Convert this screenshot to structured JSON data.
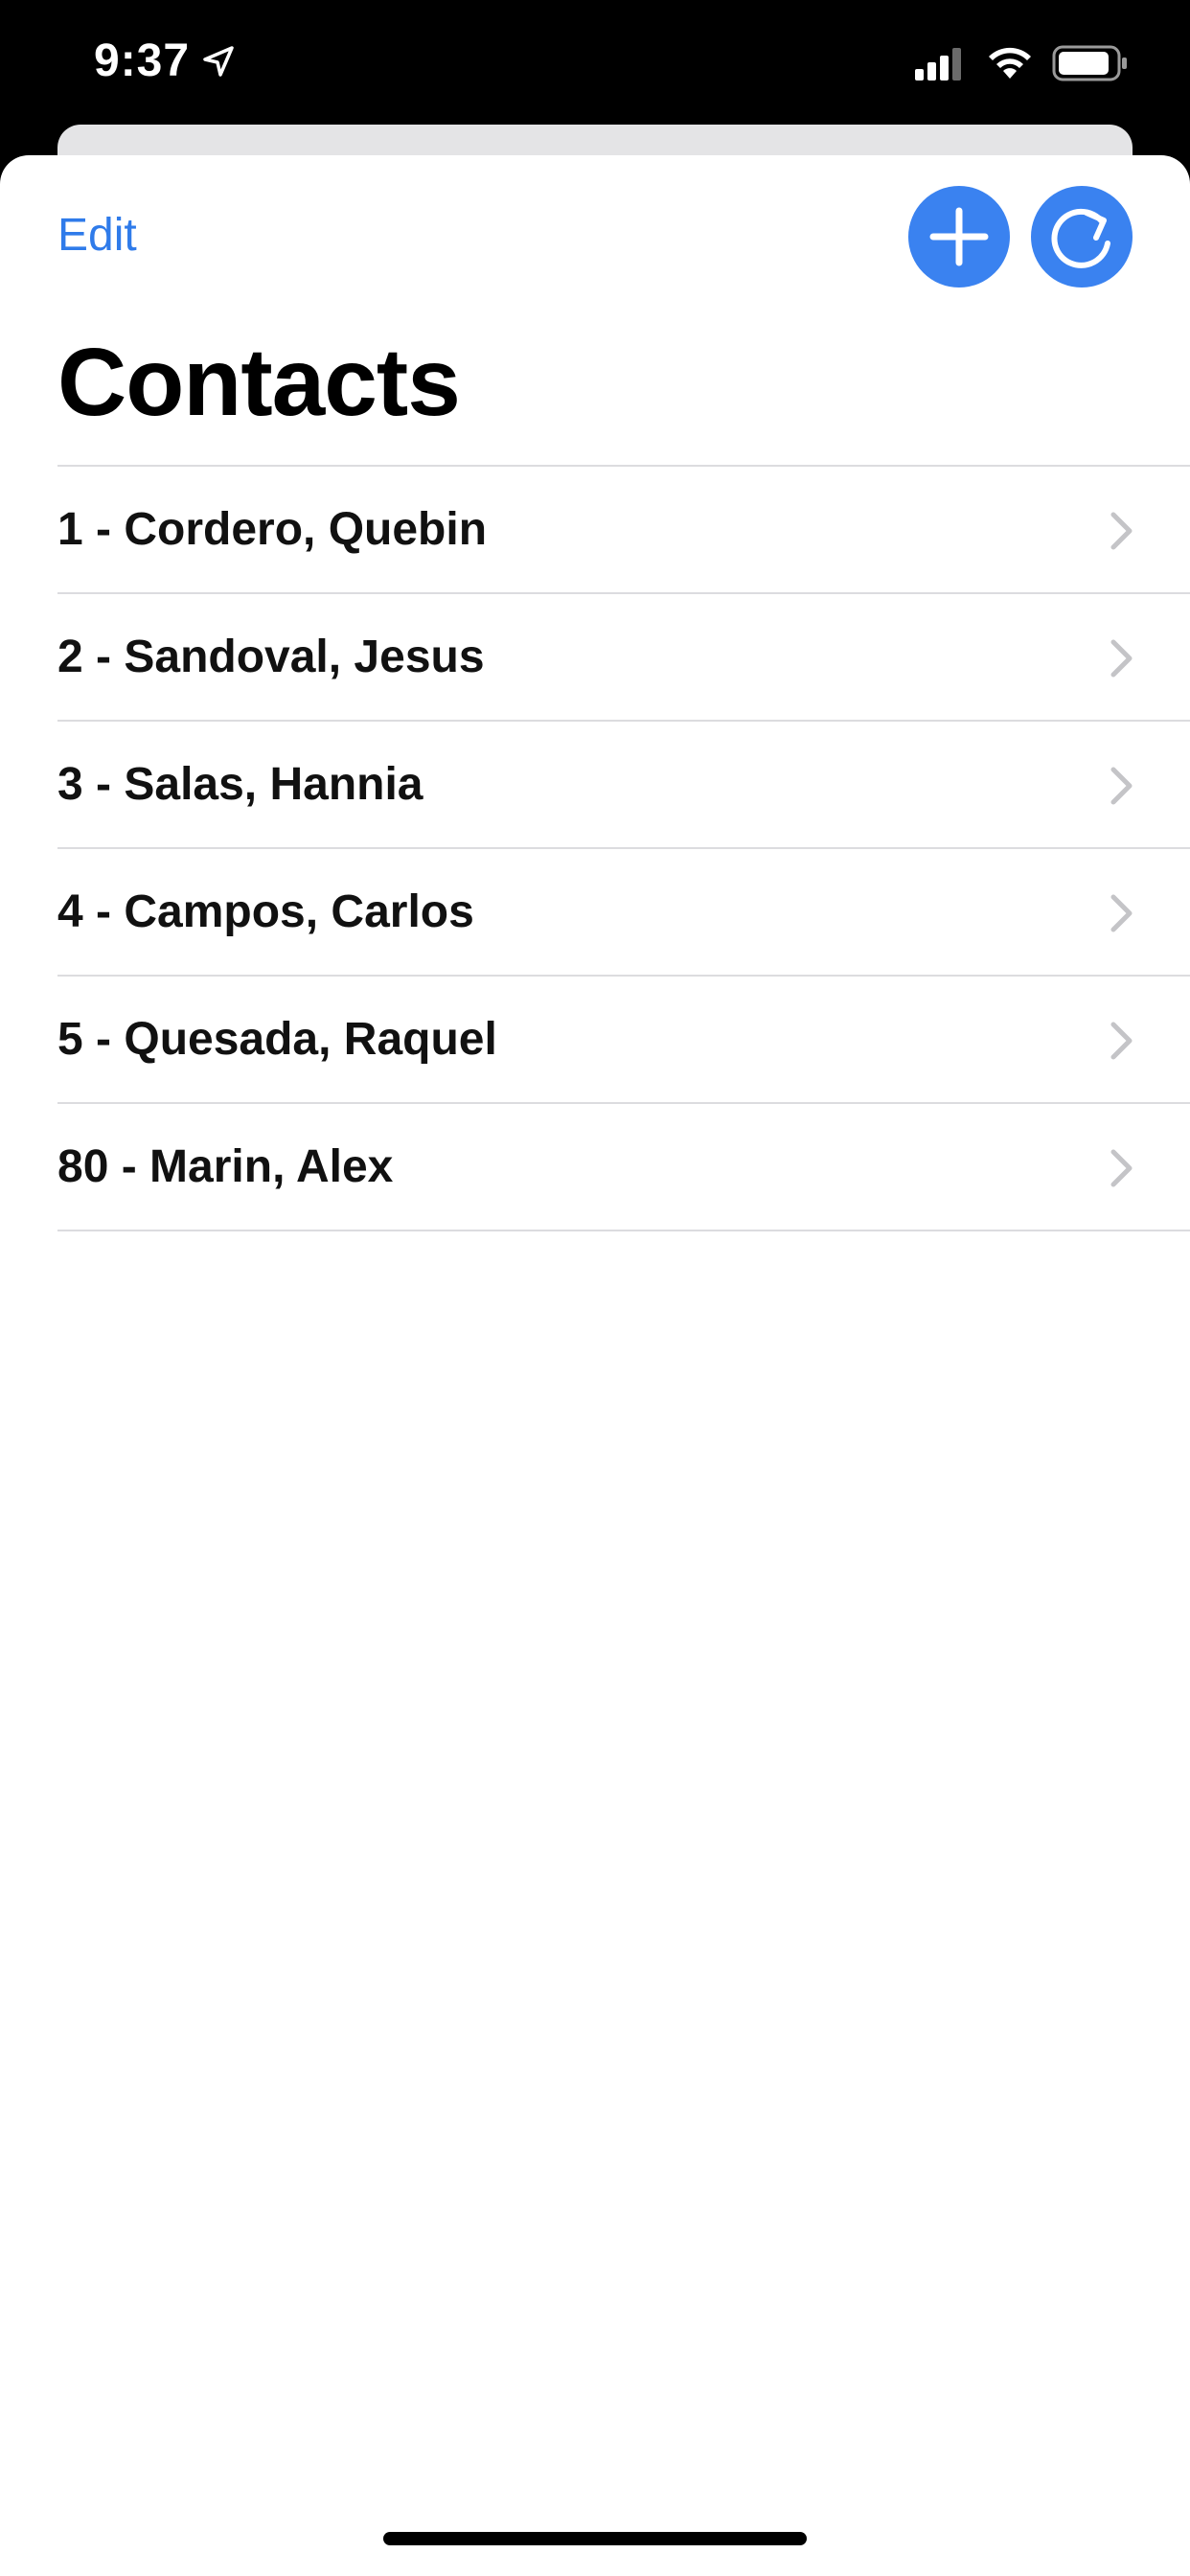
{
  "status_bar": {
    "time": "9:37",
    "icons": [
      "location-arrow-icon",
      "cellular-signal-icon",
      "wifi-icon",
      "battery-icon"
    ]
  },
  "nav": {
    "edit_label": "Edit",
    "add_icon": "plus-icon",
    "refresh_icon": "refresh-icon"
  },
  "page": {
    "title": "Contacts"
  },
  "contacts": [
    {
      "label": "1 - Cordero, Quebin"
    },
    {
      "label": "2 - Sandoval, Jesus"
    },
    {
      "label": "3 - Salas, Hannia"
    },
    {
      "label": "4 - Campos, Carlos"
    },
    {
      "label": "5 - Quesada, Raquel"
    },
    {
      "label": "80 - Marin, Alex"
    }
  ],
  "colors": {
    "accent": "#3a82f0",
    "link": "#2f7bea",
    "separator": "#dcdcdf",
    "chevron": "#c4c4c7"
  }
}
